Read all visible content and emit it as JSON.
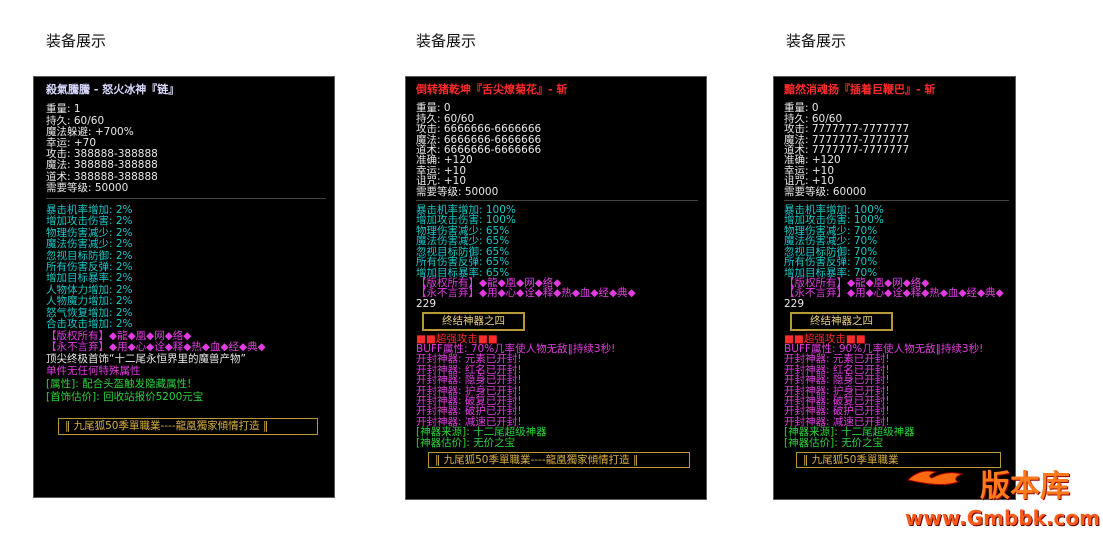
{
  "section_titles": [
    "装备展示",
    "装备展示",
    "装备展示"
  ],
  "panel1": {
    "name": "殺氣騰騰 - 怒火冰神『链』",
    "stats": [
      "重量: 1",
      "持久: 60/60",
      "魔法躲避: +700%",
      "幸运: +70",
      "攻击: 388888-388888",
      "魔法: 388888-388888",
      "道术: 388888-388888",
      "需要等级: 50000"
    ],
    "cyan_lines": [
      "暴击机率增加: 2%",
      "增加攻击伤害: 2%",
      "物理伤害减少: 2%",
      "魔法伤害减少: 2%",
      "忽视目标防御: 2%",
      "所有伤害反弹: 2%",
      "增加目标暴率: 2%",
      "人物体力增加: 2%",
      "人物魔力增加: 2%",
      "怒气恢复增加: 2%",
      "合击攻击增加: 2%"
    ],
    "mag_lines": [
      "【版权所有】◆龍◆凰◆网◆络◆",
      "【永不言弃】◆用◆心◆诠◆释◆热◆血◆经◆典◆"
    ],
    "desc1": "顶尖终极首饰“十二尾永恒界里的魔兽产物”",
    "desc2": "单件无任何特殊属性",
    "attr_line": "[属性]: 配合头盔触发隐藏属性!",
    "price_line": "[首饰估价]: 回收站报价5200元宝",
    "footer": "‖ 九尾狐50季單職業----龍凰獨家傾情打造 ‖"
  },
  "panel2": {
    "name": "倒转猪乾坤『舌尖燎菊花』- 斩",
    "stats": [
      "重量: 0",
      "持久: 60/60",
      "攻击: 6666666-6666666",
      "魔法: 6666666-6666666",
      "道术: 6666666-6666666",
      "准确: +120",
      "幸运: +10",
      "诅咒: +10",
      "需要等级: 50000"
    ],
    "cyan_lines": [
      "暴击机率增加: 100%",
      "增加攻击伤害: 100%",
      "物理伤害减少: 65%",
      "魔法伤害减少: 65%",
      "忽视目标防御: 65%",
      "所有伤害反弹: 65%",
      "增加目标暴率: 65%"
    ],
    "mag_lines": [
      "【版权所有】◆龍◆凰◆网◆络◆",
      "【永不言弃】◆用◆心◆诠◆释◆热◆血◆经◆典◆"
    ],
    "number": "229",
    "box_label": "终结神器之四",
    "red_header": "■■超强攻击■■",
    "buff_line": "BUFF属性: 70%几率使人物无敌‖持续3秒!",
    "seal_lines": [
      "开封神器: 元素已开封!",
      "开封神器: 红名已开封!",
      "开封神器: 隐身已开封!",
      "开封神器: 护身已开封!",
      "开封神器: 破复已开封!",
      "开封神器: 破护已开封!",
      "开封神器: 减速已开封!"
    ],
    "source_line": "[神器来源]: 十二尾超级神器",
    "value_line": "[神器估价]: 无价之宝",
    "footer": "‖ 九尾狐50季單職業----龍凰獨家傾情打造 ‖"
  },
  "panel3": {
    "name": "黯然消魂扬『插着巨鞭巴』- 斩",
    "stats": [
      "重量: 0",
      "持久: 60/60",
      "攻击: 7777777-7777777",
      "魔法: 7777777-7777777",
      "道术: 7777777-7777777",
      "准确: +120",
      "幸运: +10",
      "诅咒: +10",
      "需要等级: 60000"
    ],
    "cyan_lines": [
      "暴击机率增加: 100%",
      "增加攻击伤害: 100%",
      "物理伤害减少: 70%",
      "魔法伤害减少: 70%",
      "忽视目标防御: 70%",
      "所有伤害反弹: 70%",
      "增加目标暴率: 70%"
    ],
    "mag_lines": [
      "【版权所有】◆龍◆凰◆网◆络◆",
      "【永不言弃】◆用◆心◆诠◆释◆热◆血◆经◆典◆"
    ],
    "number": "229",
    "box_label": "终结神器之四",
    "red_header": "■■超强攻击■■",
    "buff_line": "BUFF属性: 90%几率使人物无敌‖持续3秒!",
    "seal_lines": [
      "开封神器: 元素已开封!",
      "开封神器: 红名已开封!",
      "开封神器: 隐身已开封!",
      "开封神器: 护身已开封!",
      "开封神器: 破复已开封!",
      "开封神器: 破护已开封!",
      "开封神器: 减速已开封!"
    ],
    "source_line": "[神器来源]: 十二尾超级神器",
    "value_line": "[神器估价]: 无价之宝",
    "footer": "‖ 九尾狐50季單職業"
  },
  "watermark": {
    "brand": "版本库",
    "url": "www.Gmbbk.com"
  }
}
